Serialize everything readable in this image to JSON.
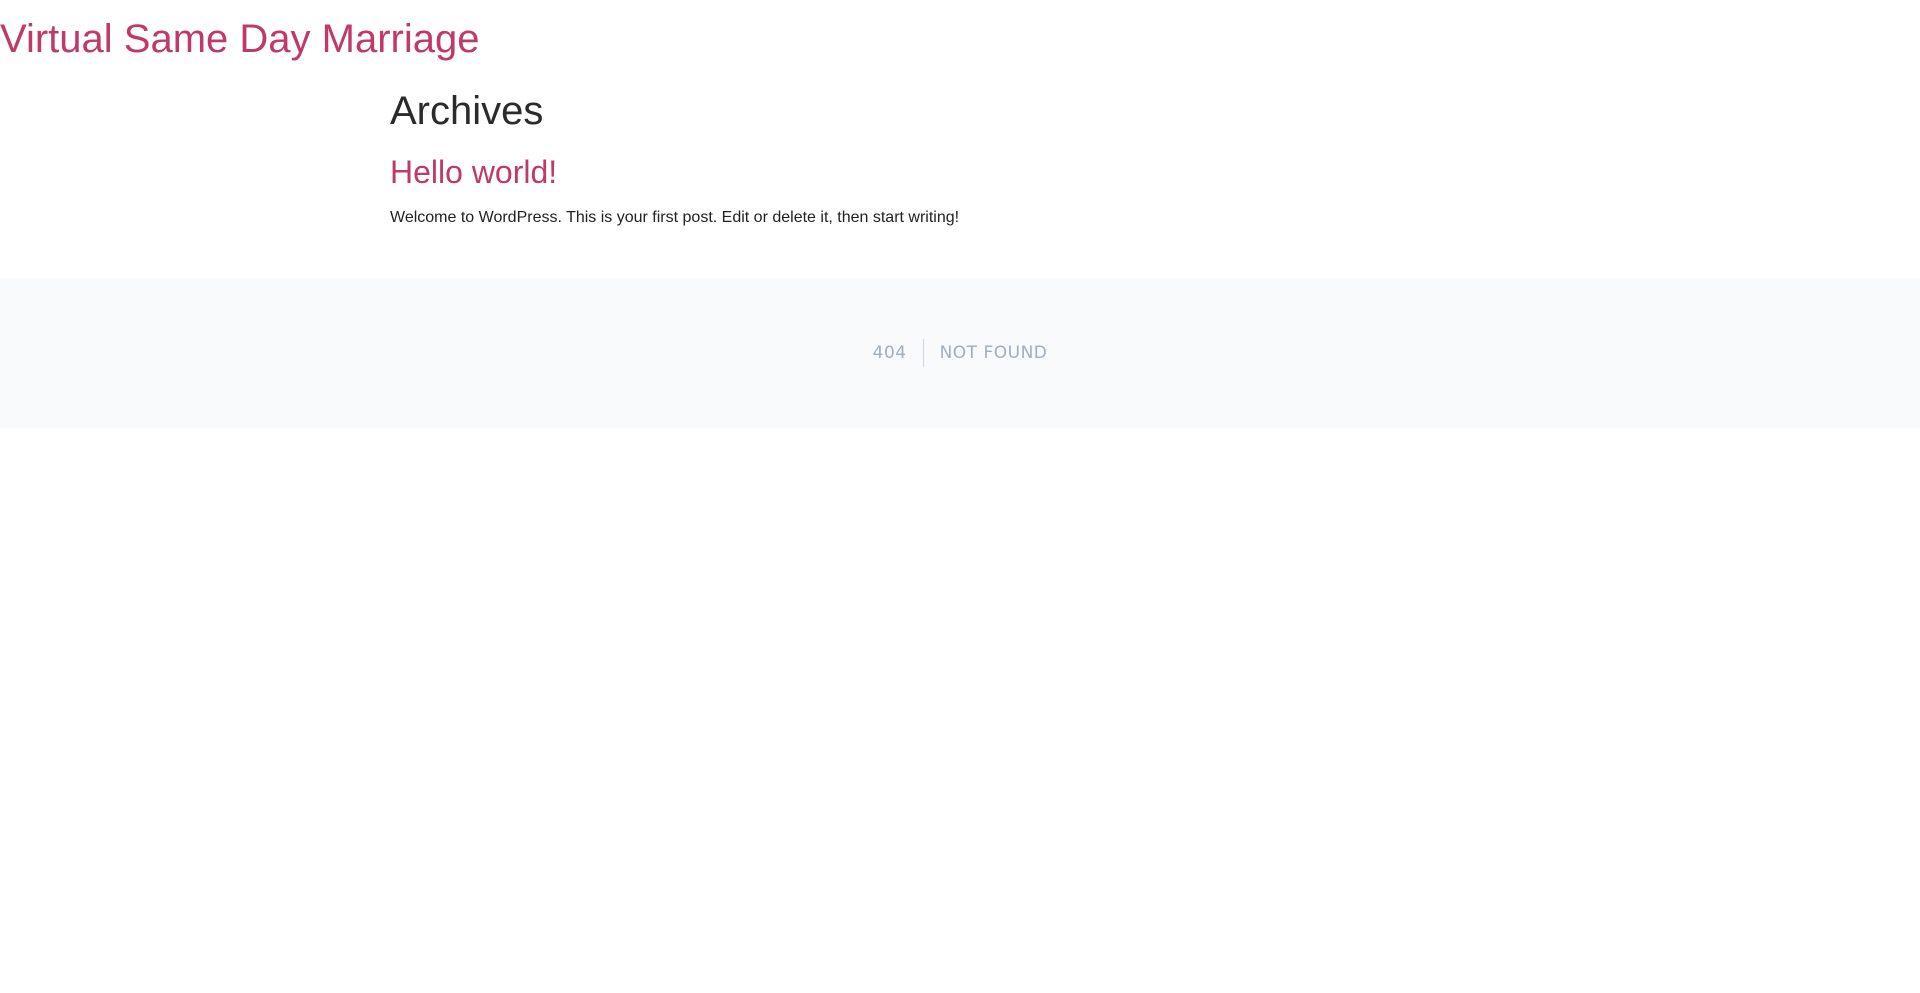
{
  "site": {
    "title": "Virtual Same Day Marriage"
  },
  "archive": {
    "heading": "Archives"
  },
  "post": {
    "title": "Hello world!",
    "excerpt": "Welcome to WordPress. This is your first post. Edit or delete it, then start writing!"
  },
  "error": {
    "code": "404",
    "message": "NOT FOUND"
  },
  "colors": {
    "link": "#c0396b",
    "heading": "#2b2b2b",
    "text": "#222222",
    "error_text": "#a0aec0",
    "error_band": "#f8fafb"
  }
}
